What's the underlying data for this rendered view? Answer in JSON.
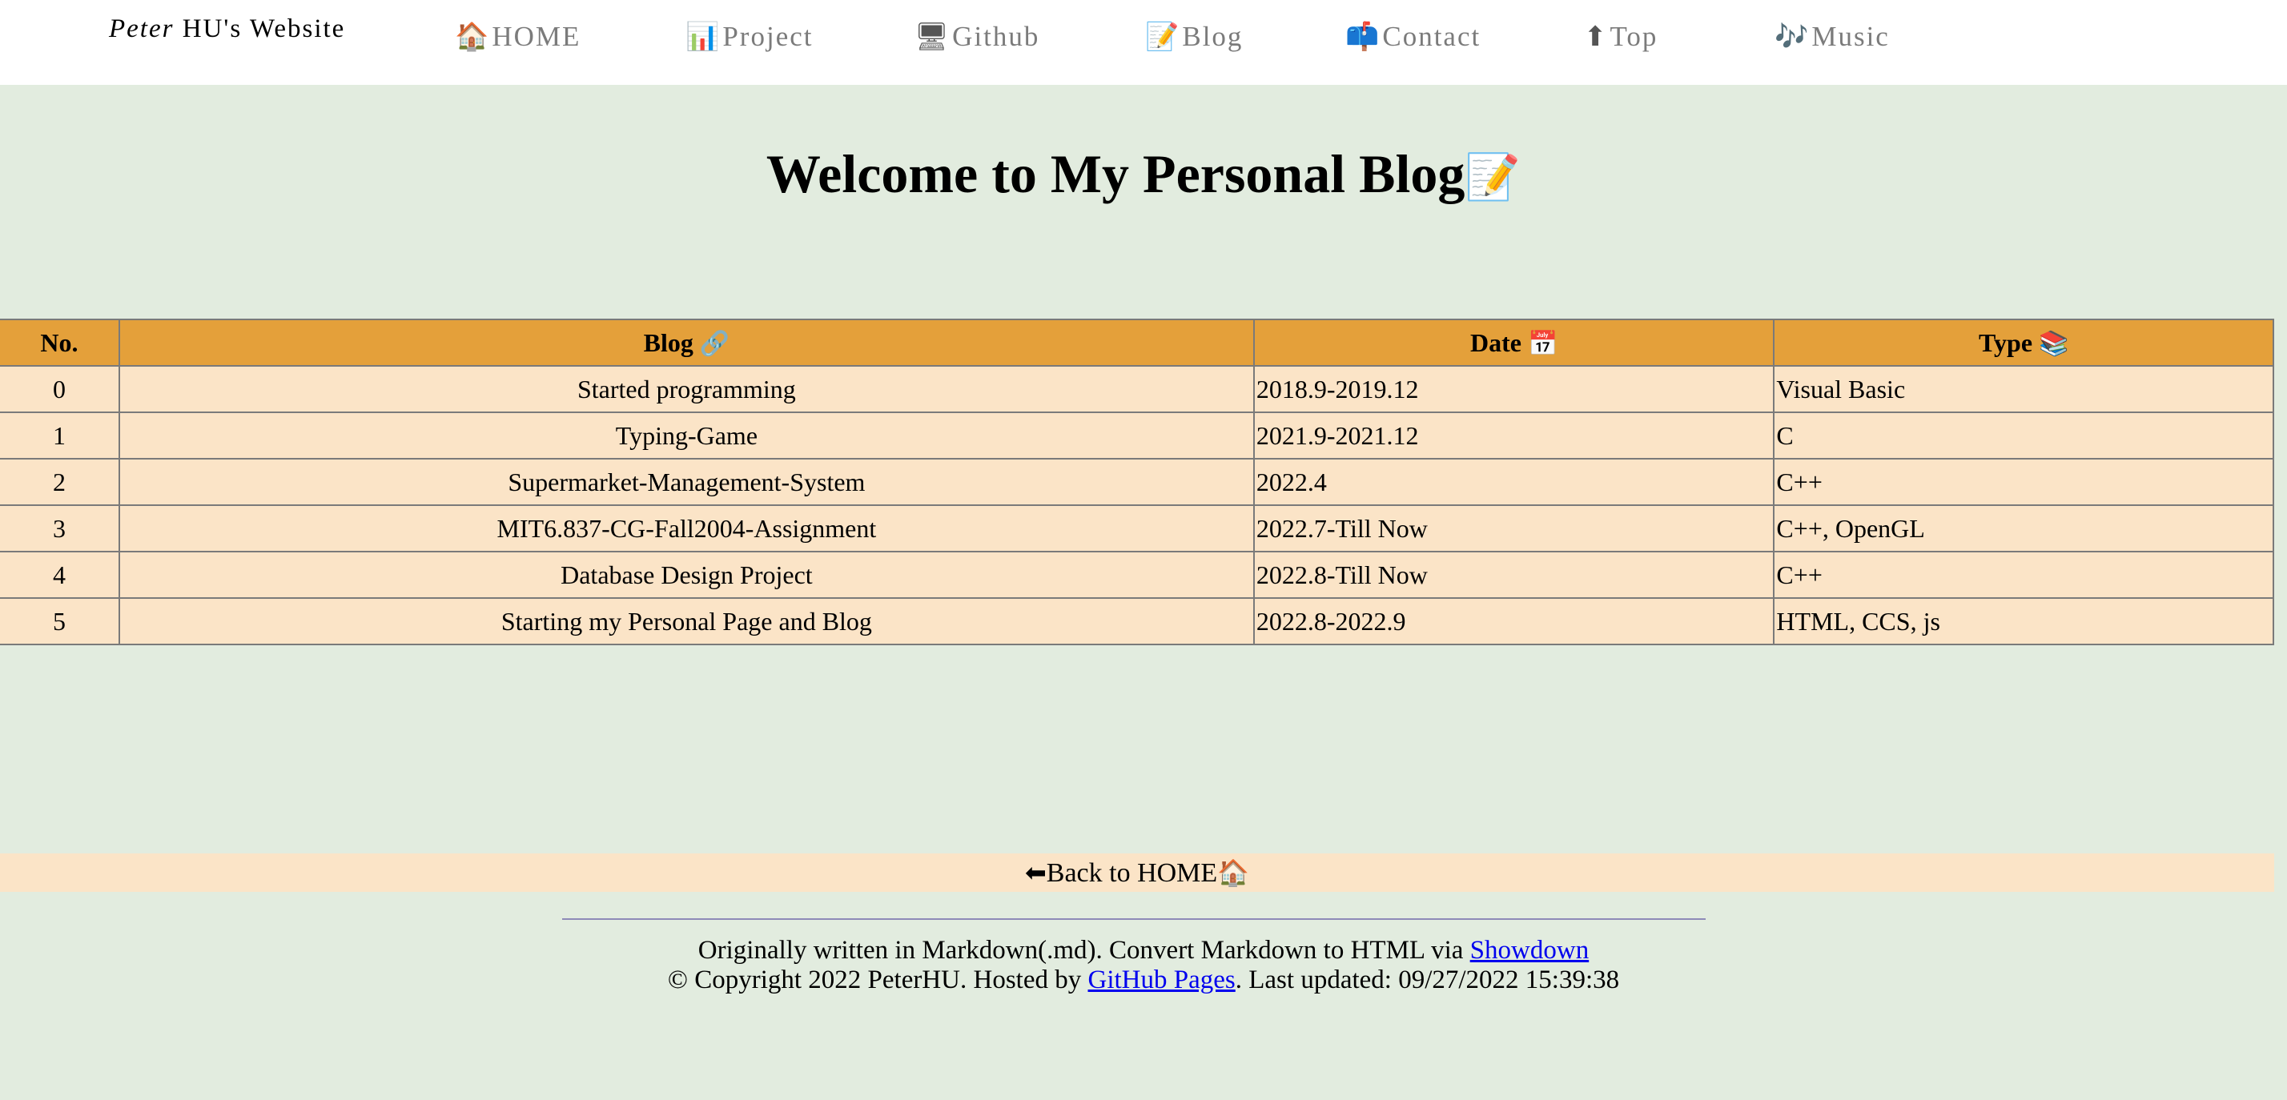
{
  "brand": {
    "first": "Peter",
    "rest": " HU's Website"
  },
  "nav": [
    {
      "icon": "🏠",
      "icon_name": "house-icon",
      "label": "HOME"
    },
    {
      "icon": "📊",
      "icon_name": "bar-chart-icon",
      "label": "Project"
    },
    {
      "icon": "🖥",
      "icon_name": "desktop-computer-icon",
      "label": "Github"
    },
    {
      "icon": "📝",
      "icon_name": "memo-icon",
      "label": "Blog"
    },
    {
      "icon": "📫",
      "icon_name": "mailbox-icon",
      "label": "Contact"
    },
    {
      "icon": "⬆",
      "icon_name": "up-arrow-icon",
      "label": "Top"
    },
    {
      "icon": "🎶",
      "icon_name": "music-notes-icon",
      "label": "Music"
    }
  ],
  "page_title": "Welcome to My Personal Blog",
  "page_title_icon": "📝",
  "table": {
    "headers": {
      "no": "No.",
      "blog": "Blog",
      "blog_icon": "🔗",
      "date": "Date",
      "date_icon": "📅",
      "type": "Type",
      "type_icon": "📚"
    },
    "rows": [
      {
        "no": "0",
        "blog": "Started programming",
        "date": "2018.9-2019.12",
        "type": "Visual Basic"
      },
      {
        "no": "1",
        "blog": "Typing-Game",
        "date": "2021.9-2021.12",
        "type": "C"
      },
      {
        "no": "2",
        "blog": "Supermarket-Management-System",
        "date": "2022.4",
        "type": "C++"
      },
      {
        "no": "3",
        "blog": "MIT6.837-CG-Fall2004-Assignment",
        "date": "2022.7-Till Now",
        "type": "C++, OpenGL"
      },
      {
        "no": "4",
        "blog": "Database Design Project",
        "date": "2022.8-Till Now",
        "type": "C++"
      },
      {
        "no": "5",
        "blog": "Starting my Personal Page and Blog",
        "date": "2022.8-2022.9",
        "type": "HTML, CCS, js"
      }
    ]
  },
  "back": {
    "icon_left": "⬅",
    "label": "Back to HOME",
    "icon_right": "🏠"
  },
  "footer": {
    "line1_prefix": "Originally written in Markdown(.md). Convert Markdown to HTML via ",
    "showdown_link": "Showdown",
    "line2_prefix": "© Copyright 2022 PeterHU. Hosted by ",
    "github_pages_link": "GitHub Pages",
    "line2_suffix": ". Last updated: 09/27/2022 15:39:38"
  },
  "colors": {
    "page_bg": "#e2ecdf",
    "header_bg": "#e4a03a",
    "row_bg": "#fbe4c7",
    "link": "#0000ee",
    "nav_text": "#7b7b7b"
  }
}
